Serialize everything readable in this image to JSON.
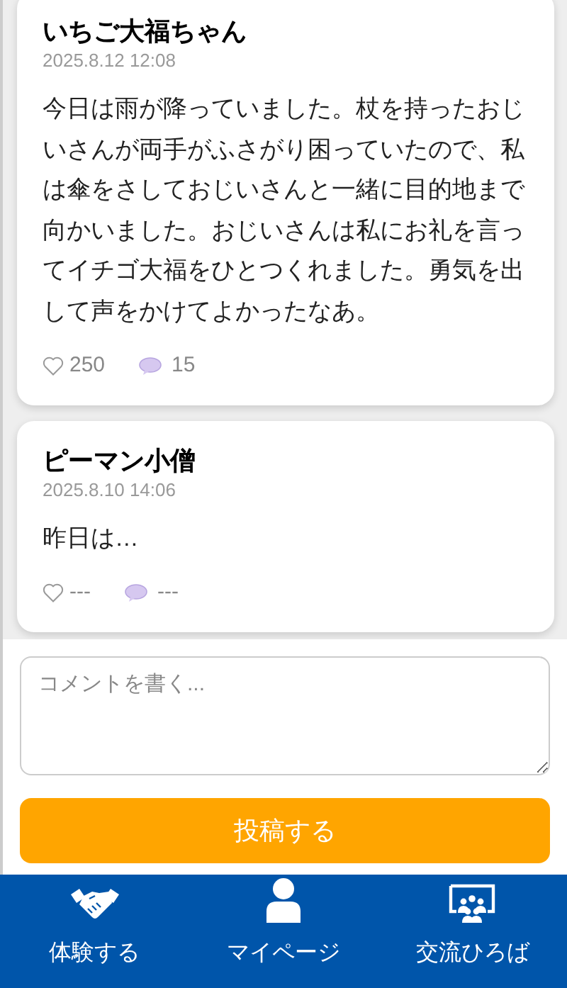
{
  "posts": [
    {
      "author": "いちご大福ちゃん",
      "date": "2025.8.12 12:08",
      "body": "今日は雨が降っていました。杖を持ったおじいさんが両手がふさがり困っていたので、私は傘をさしておじいさんと一緒に目的地まで向かいました。おじいさんは私にお礼を言ってイチゴ大福をひとつくれました。勇気を出して声をかけてよかったなあ。",
      "likes": "250",
      "comments": "15"
    },
    {
      "author": "ピーマン小僧",
      "date": "2025.8.10 14:06",
      "body": "昨日は…",
      "likes": "---",
      "comments": "---"
    }
  ],
  "composer": {
    "placeholder": "コメントを書く...",
    "submit": "投稿する"
  },
  "nav": [
    {
      "kind": "handshake",
      "label": "体験する"
    },
    {
      "kind": "person",
      "label": "マイページ"
    },
    {
      "kind": "group",
      "label": "交流ひろば"
    }
  ]
}
